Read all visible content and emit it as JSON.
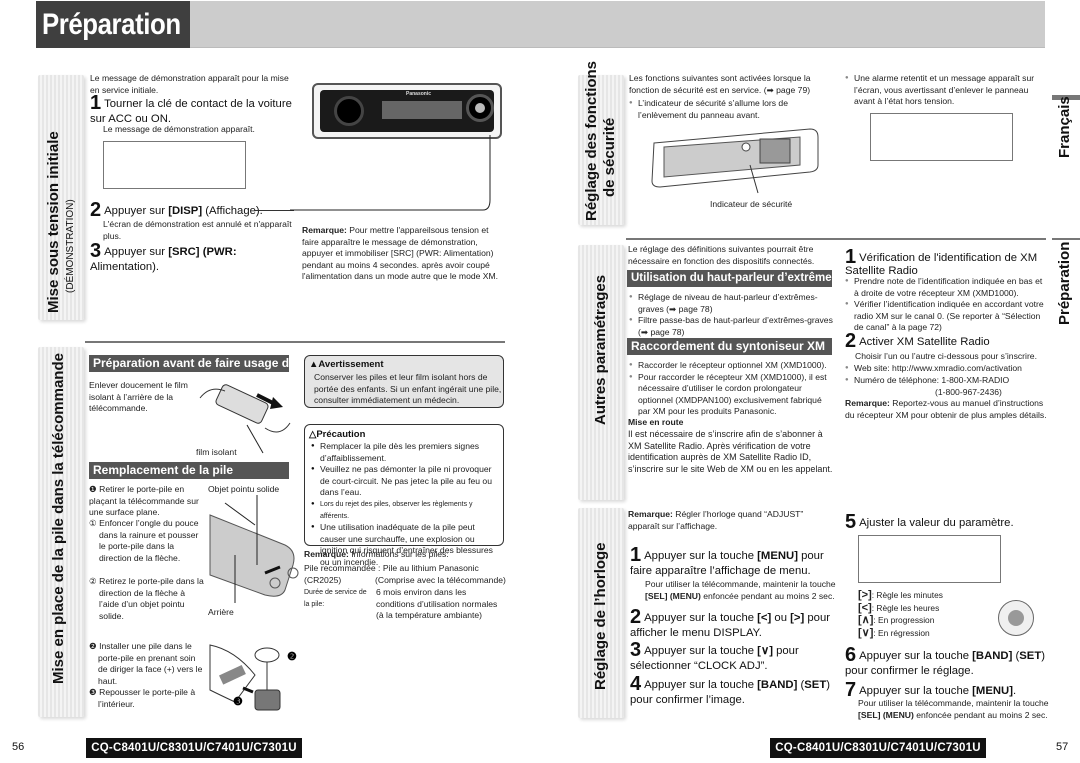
{
  "header": {
    "title": "Préparation"
  },
  "left_page": {
    "section1": {
      "tab_title": "Mise sous tension initiale",
      "tab_sub": "(DÉMONSTRATION)",
      "intro": "Le message de démonstration apparaît pour la mise en service initiale.",
      "steps": [
        {
          "num": "1",
          "text": "Tourner la clé de contact de la voiture sur ACC ou ON.",
          "note": "Le message de démonstration apparaît."
        },
        {
          "num": "2",
          "text_pre": "Appuyer sur ",
          "key": "[DISP]",
          "text_post": " (Affichage).",
          "note": "L'écran de démonstration est annulé et n'apparaît plus."
        },
        {
          "num": "3",
          "text_pre": "Appuyer sur ",
          "key": "[SRC] (PWR:",
          "text_post": " Alimentation)."
        }
      ],
      "remark_label": "Remarque:",
      "remark_text": " Pour mettre l'appareilsous tension et faire apparaître le message de démonstration, appuyer et immobiliser [SRC] (PWR: Alimentation) pendant au moins 4 secondes. après avoir coupé l'alimentation dans un mode autre que le mode XM.",
      "device_label": "Panasonic"
    },
    "section2": {
      "tab_title": "Mise en place de la pile dans la télécommande",
      "prep_header": "Préparation avant de faire usage de l’appareil",
      "prep_text": "Enlever doucement le film isolant à l’arrière de la télécommande.",
      "film_label": "film isolant",
      "replace_header": "Remplacement de la pile",
      "replace_steps": [
        {
          "marker": "❶",
          "text": "Retirer le porte-pile en plaçant la télécommande sur une surface plane."
        },
        {
          "marker": "①",
          "text": "Enfoncer l’ongle du pouce dans la rainure et pousser le porte-pile dans la direction de la flèche."
        },
        {
          "marker": "②",
          "text": "Retirez le porte-pile dans la direction de la flèche à l’aide d’un objet pointu solide."
        },
        {
          "marker": "❷",
          "text": "Installer une pile dans le porte-pile en prenant soin de diriger la face (+) vers le haut."
        },
        {
          "marker": "❸",
          "text": "Repousser le porte-pile à l’intérieur."
        }
      ],
      "tool_label": "Objet pointu solide",
      "back_label": "Arrière",
      "warning": {
        "title": "Avertissement",
        "text": "Conserver les piles et leur film isolant hors de portée des enfants. Si un enfant ingérait une pile, consulter immédiatement un médecin."
      },
      "caution": {
        "title": "Précaution",
        "items": [
          "Remplacer la pile dès les premiers signes d’affaiblissement.",
          "Veuillez ne pas démonter la pile ni provoquer de court-circuit. Ne pas jetec la pile au feu ou dans l’eau.",
          "Lors du rejet des piles, observer les règlements y afférents.",
          "Une utilisation inadéquate de la pile peut causer une surchauffe, une explosion ou ignition qui risquent d’entraîner des blessures ou un incendie."
        ]
      },
      "battery_remark_label": "Remarque:",
      "battery_remark_text": " Informations sur les piles:",
      "battery_rec_label": "Pile recommandée :",
      "battery_rec_value": "Pile au lithium Panasonic (CR2025)",
      "battery_rec_note": "(Comprise avec la télécommande)",
      "battery_life_label": "Durée de service de la pile:",
      "battery_life_value": "6 mois environ dans les conditions d’utilisation normales (à la température ambiante)"
    },
    "footer": {
      "page": "56",
      "model": "CQ-C8401U/C8301U/C7401U/C7301U"
    }
  },
  "right_page": {
    "security": {
      "tab_title_1": "Réglage des fonctions",
      "tab_title_2": "de sécurité",
      "intro": "Les fonctions suivantes sont activées lorsque la fonction de sécurité est en service. (➡ page 79)",
      "bullets": [
        "L’indicateur de sécurité s’allume lors de l’enlèvement du panneau avant.",
        "Une alarme retentit et un message apparaît sur l’écran, vous avertissant d’enlever le panneau avant à l’état hors tension."
      ],
      "indicator_label": "Indicateur de sécurité"
    },
    "other": {
      "tab_title": "Autres paramétrages",
      "intro": "Le réglage des définitions suivantes pourrait être nécessaire en fonction des dispositifs connectés.",
      "sub_header": "Utilisation du haut-parleur d’extrêmes-graves",
      "sub_items": [
        "Réglage de niveau de haut-parleur d’extrêmes-graves (➡ page 78)",
        "Filtre passe-bas de haut-parleur d’extrêmes-graves (➡ page 78)"
      ],
      "xm_header": "Raccordement du syntoniseur XM",
      "xm_items": [
        "Raccorder le récepteur optionnel XM (XMD1000).",
        "Pour raccorder le récepteur XM (XMD1000), il est nécessaire d’utiliser le cordon prolongateur optionnel (XMDPAN100) exclusivement fabriqué par XM pour les produits Panasonic."
      ],
      "start_title": "Mise en route",
      "start_text": "Il est nécessaire de s’inscrire afin de s’abonner à XM Satellite Radio. Après vérification de votre identification auprès de XM Satellite Radio ID, s’inscrire sur le site Web de XM ou en les appelant.",
      "steps": [
        {
          "num": "1",
          "text": "Vérification de l'identification de XM Satellite Radio",
          "items": [
            "Prendre note de l’identification indiquée en bas et à droite de votre récepteur XM (XMD1000).",
            "Vérifier l’identification indiquée en accordant votre radio XM sur le canal 0. (Se reporter à “Sélection de canal” à la page 72)"
          ]
        },
        {
          "num": "2",
          "text": "Activer XM Satellite Radio",
          "note": "Choisir l’un ou l’autre ci-dessous pour s’inscrire.",
          "items": [
            "Web site: http://www.xmradio.com/activation",
            "Numéro de téléphone: 1-800-XM-RADIO"
          ],
          "phone_alt": "(1-800-967-2436)"
        }
      ],
      "remark_label": "Remarque:",
      "remark_text": " Reportez-vous au manuel d’instructions du récepteur XM pour obtenir de plus amples détails."
    },
    "clock": {
      "tab_title": "Réglage de l’horloge",
      "remark_label": "Remarque:",
      "remark_text": " Régler l’horloge quand “ADJUST” apparaît sur l’affichage.",
      "steps": [
        {
          "num": "1",
          "pre": "Appuyer sur la touche ",
          "key": "[MENU]",
          "post": " pour faire apparaître l’affichage de menu.",
          "note_pre": "Pour utiliser la télécommande, maintenir la touche ",
          "note_key": "[SEL] (MENU)",
          "note_post": " enfoncée pendant au moins 2 sec."
        },
        {
          "num": "2",
          "pre": "Appuyer sur la touche ",
          "key": "[<]",
          "mid": " ou ",
          "key2": "[>]",
          "post": " pour afficher le menu DISPLAY."
        },
        {
          "num": "3",
          "pre": "Appuyer sur la touche ",
          "key": "[∨]",
          "post": " pour sélectionner “CLOCK ADJ”."
        },
        {
          "num": "4",
          "pre": "Appuyer sur la touche ",
          "key": "[BAND]",
          "mid": " (",
          "key2": "SET",
          "post": ") pour confirmer l’image."
        },
        {
          "num": "5",
          "pre": "Ajuster la valeur du paramètre."
        },
        {
          "num": "6",
          "pre": "Appuyer sur la touche ",
          "key": "[BAND]",
          "mid": " (",
          "key2": "SET",
          "post": ") pour confirmer le réglage."
        },
        {
          "num": "7",
          "pre": "Appuyer sur la touche ",
          "key": "[MENU]",
          "post": ".",
          "note_pre": "Pour utiliser la télécommande, maintenir la touche ",
          "note_key": "[SEL] (MENU)",
          "note_post": " enfoncée pendant au moins 2 sec."
        }
      ],
      "key_legend": [
        {
          "key": "[>]",
          "text": ": Règle les minutes"
        },
        {
          "key": "[<]",
          "text": ": Règle les heures"
        },
        {
          "key": "[∧]",
          "text": ": En progression"
        },
        {
          "key": "[∨]",
          "text": ": En régression"
        }
      ]
    },
    "side_tabs": {
      "language": "Français",
      "chapter": "Préparation"
    },
    "footer": {
      "page": "57",
      "model": "CQ-C8401U/C8301U/C7401U/C7301U"
    }
  }
}
